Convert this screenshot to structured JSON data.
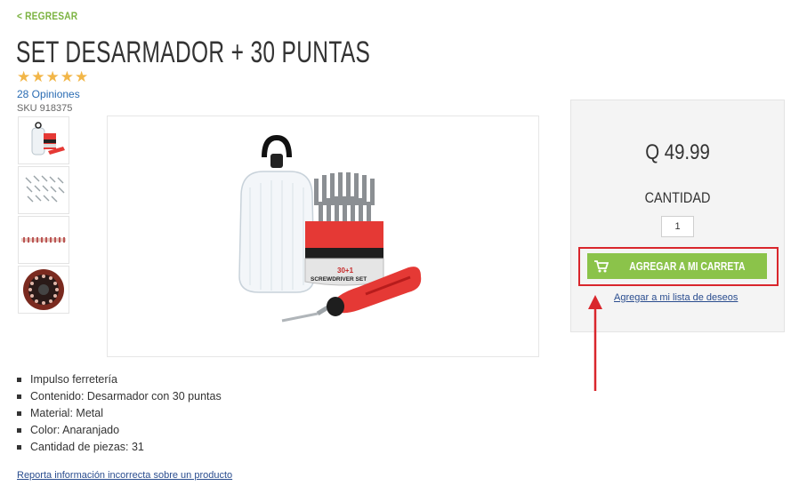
{
  "nav": {
    "back_label": "< REGRESAR"
  },
  "product": {
    "title": "SET DESARMADOR + 30 PUNTAS",
    "rating_stars": 5,
    "reviews_label": "28 Opiniones",
    "sku_label": "SKU 918375",
    "image_caption": {
      "line1": "30+1",
      "line2": "SCREWDRIVER SET"
    },
    "features": [
      "Impulso ferretería",
      "Contenido: Desarmador con 30 puntas",
      "Material: Metal",
      "Color: Anaranjado",
      "Cantidad de piezas: 31"
    ],
    "report_link": "Reporta información incorrecta sobre un producto"
  },
  "purchase": {
    "price": "Q 49.99",
    "quantity_label": "CANTIDAD",
    "quantity_value": "1",
    "add_to_cart_label": "AGREGAR A MI CARRETA",
    "wishlist_label": "Agregar a mi lista de deseos"
  },
  "icons": {
    "cart": "cart-icon",
    "star": "star-icon"
  },
  "colors": {
    "accent_green": "#8bc34a",
    "link_green": "#7cb342",
    "star": "#f2b648",
    "link_blue": "#2a6cb3",
    "highlight_red": "#d9262c",
    "product_red": "#e53935"
  }
}
